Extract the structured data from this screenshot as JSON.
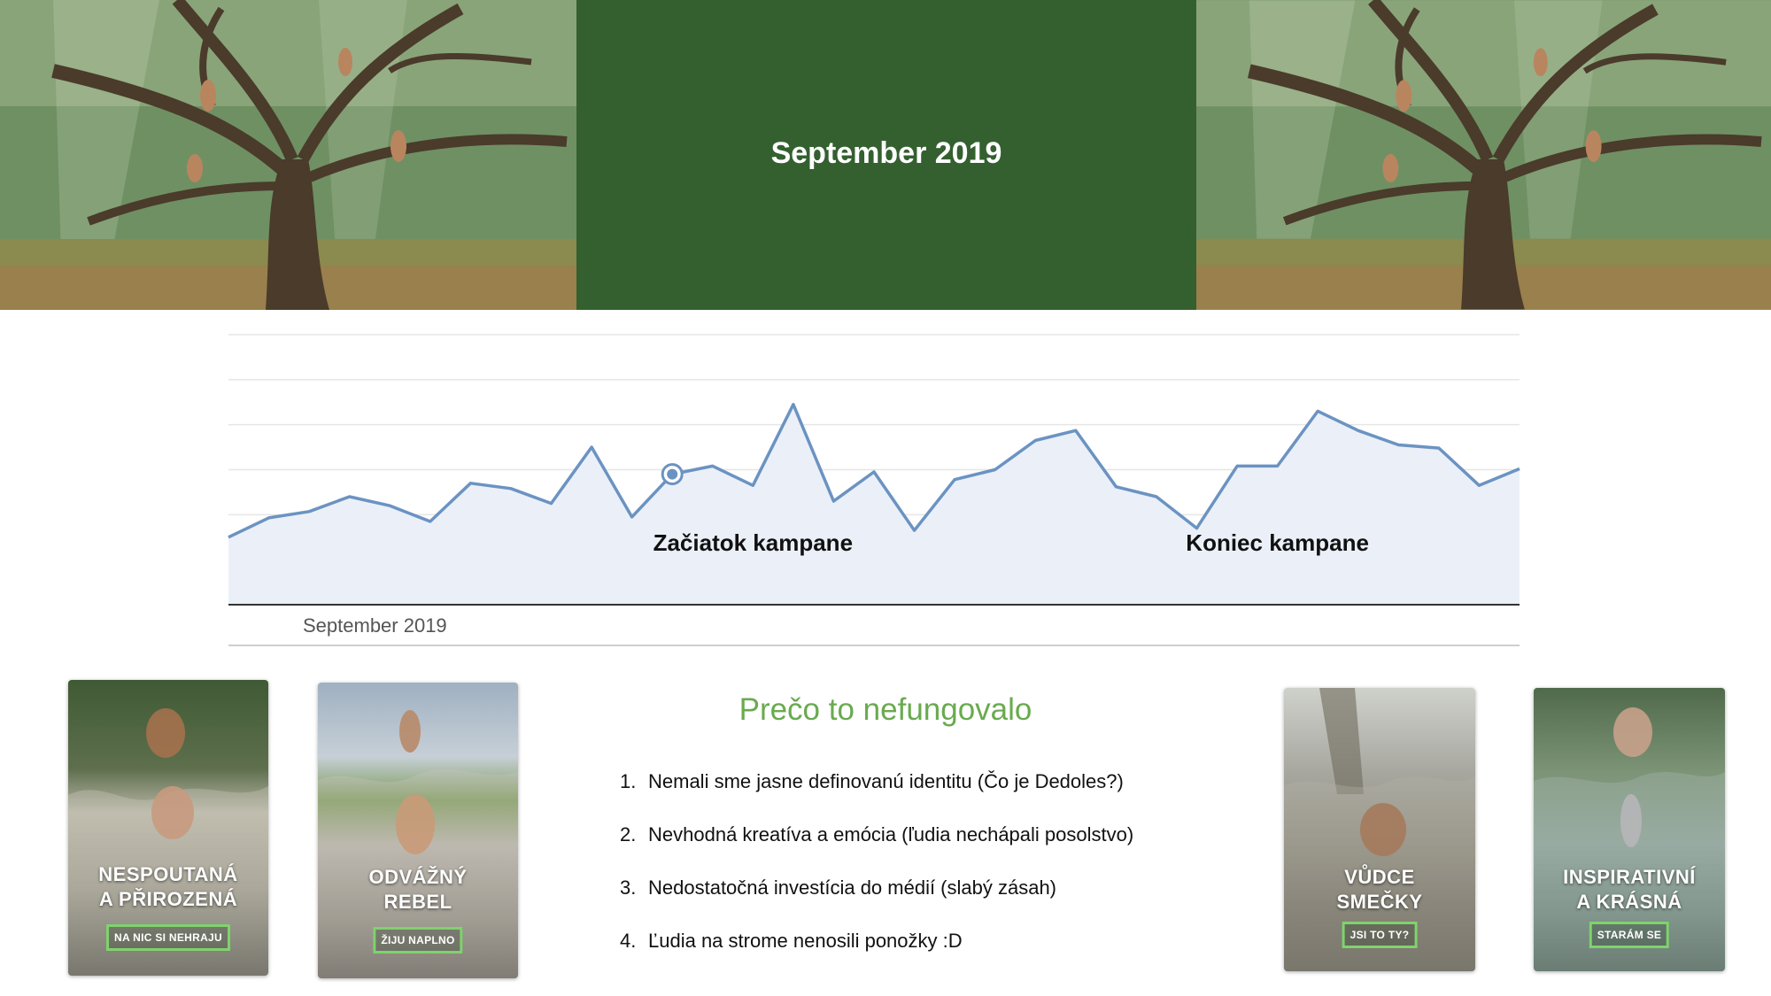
{
  "header": {
    "title": "September 2019"
  },
  "colors": {
    "panel_green": "#346030",
    "heading_green": "#6aaa4f",
    "line_blue": "#6b93c2",
    "area_fill": "#ebf0f8",
    "button_border": "#7fd36d"
  },
  "chart_data": {
    "type": "area",
    "title": "",
    "xlabel": "",
    "ylabel": "",
    "x_tick_labels": [
      "September 2019"
    ],
    "grid": true,
    "legend": "none",
    "ylim": [
      0,
      6
    ],
    "series": [
      {
        "values": [
          1.5,
          1.93,
          2.07,
          2.4,
          2.2,
          1.85,
          2.7,
          2.58,
          2.25,
          3.5,
          1.95,
          2.9,
          3.08,
          2.65,
          4.45,
          2.3,
          2.95,
          1.65,
          2.78,
          3.0,
          3.65,
          3.87,
          2.62,
          2.4,
          1.7,
          3.08,
          3.08,
          4.3,
          3.87,
          3.55,
          3.48,
          2.65,
          3.02
        ]
      }
    ],
    "highlight_point_index": 11,
    "annotations": [
      {
        "text": "Začiatok kampane",
        "x_index": 13
      },
      {
        "text": "Koniec kampane",
        "x_index": 26
      }
    ]
  },
  "main": {
    "heading": "Prečo to nefungovalo",
    "reasons": [
      {
        "num": "1.",
        "text": "Nemali sme jasne definovanú identitu (Čo je Dedoles?)"
      },
      {
        "num": "2.",
        "text": "Nevhodná kreatíva a emócia (ľudia nechápali posolstvo)"
      },
      {
        "num": "3.",
        "text": "Nedostatočná investícia do médií (slabý zásah)"
      },
      {
        "num": "4.",
        "text": "Ľudia na strome nenosili ponožky :D"
      }
    ]
  },
  "cards": [
    {
      "line1": "NESPOUTANÁ",
      "line2": "A PŘIROZENÁ",
      "button": "NA NIC SI NEHRAJU"
    },
    {
      "line1": "ODVÁŽNÝ",
      "line2": "REBEL",
      "button": "ŽIJU NAPLNO"
    },
    {
      "line1": "VŮDCE",
      "line2": "SMEČKY",
      "button": "JSI TO TY?"
    },
    {
      "line1": "INSPIRATIVNÍ",
      "line2": "A KRÁSNÁ",
      "button": "STARÁM SE"
    }
  ]
}
